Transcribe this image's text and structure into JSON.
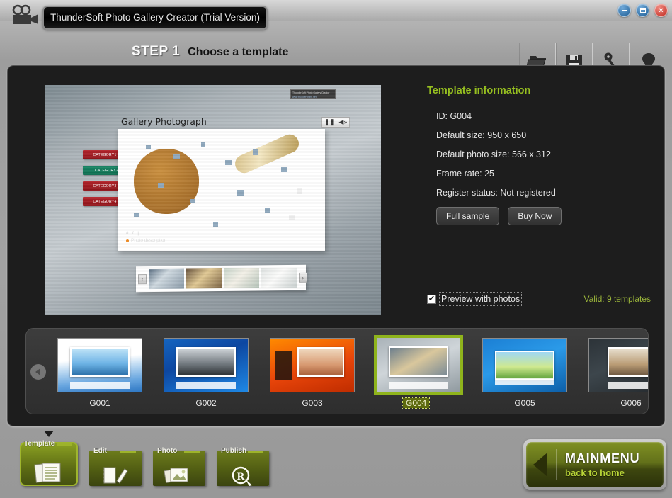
{
  "window": {
    "title": "ThunderSoft Photo Gallery Creator (Trial Version)",
    "logo_icon": "video-camera-icon",
    "controls": {
      "minimize": "minimize-icon",
      "maximize": "maximize-icon",
      "close": "×"
    }
  },
  "header": {
    "step_number": "STEP 1",
    "step_title": "Choose a template",
    "toolbar": [
      {
        "label": "File",
        "icon": "folder-icon"
      },
      {
        "label": "Save",
        "icon": "floppy-disk-icon"
      },
      {
        "label": "Register",
        "icon": "key-icon"
      },
      {
        "label": "Help",
        "icon": "lightbulb-icon"
      }
    ]
  },
  "preview": {
    "watermark_line1": "ThunderSoft Photo Gallery Creator",
    "watermark_line2": "www.thundershare.net",
    "gallery_title": "Gallery Photograph",
    "controls": {
      "pause": "❚❚",
      "volume": "◀»"
    },
    "categories": [
      {
        "label": "CATEGORY1",
        "state": "normal"
      },
      {
        "label": "CATEGORY2",
        "state": "selected"
      },
      {
        "label": "CATEGORY3",
        "state": "normal"
      },
      {
        "label": "CATEGORY4",
        "state": "normal"
      }
    ],
    "photo_marks": "# f |",
    "photo_description": "Photo description",
    "filmstrip": {
      "prev": "‹",
      "next": "›",
      "thumbs": [
        "coffee-cup-blue",
        "coffee-cup-brown",
        "cappuccino-white",
        "two-cups-white"
      ]
    }
  },
  "info": {
    "title": "Template information",
    "rows": [
      "ID: G004",
      "Default size: 950 x 650",
      "Default photo size: 566 x 312",
      "Frame rate: 25",
      "Register status: Not registered"
    ],
    "buttons": [
      {
        "label": "Full sample"
      },
      {
        "label": "Buy Now"
      }
    ],
    "preview_checkbox": {
      "label": "Preview with photos",
      "checked": true,
      "mark": "✔"
    },
    "valid_text": "Valid: 9 templates",
    "accent_color": "#97c020"
  },
  "carousel": {
    "prev_icon": "chevron-left-icon",
    "next_icon": "chevron-right-icon",
    "templates": [
      {
        "id": "G001",
        "selected": false,
        "art": "th1"
      },
      {
        "id": "G002",
        "selected": false,
        "art": "th2"
      },
      {
        "id": "G003",
        "selected": false,
        "art": "th3"
      },
      {
        "id": "G004",
        "selected": true,
        "art": "th4"
      },
      {
        "id": "G005",
        "selected": false,
        "art": "th5"
      },
      {
        "id": "G006",
        "selected": false,
        "art": "th6"
      }
    ]
  },
  "footer": {
    "steps": [
      {
        "label": "Template",
        "icon": "documents-icon",
        "active": true
      },
      {
        "label": "Edit",
        "icon": "notepad-pencil-icon",
        "active": false
      },
      {
        "label": "Photo",
        "icon": "photos-icon",
        "active": false
      },
      {
        "label": "Publish",
        "icon": "registered-mark-icon",
        "active": false
      }
    ],
    "mainmenu": {
      "title": "MAINMENU",
      "subtitle": "back to home",
      "icon": "back-chevron-icon"
    }
  }
}
